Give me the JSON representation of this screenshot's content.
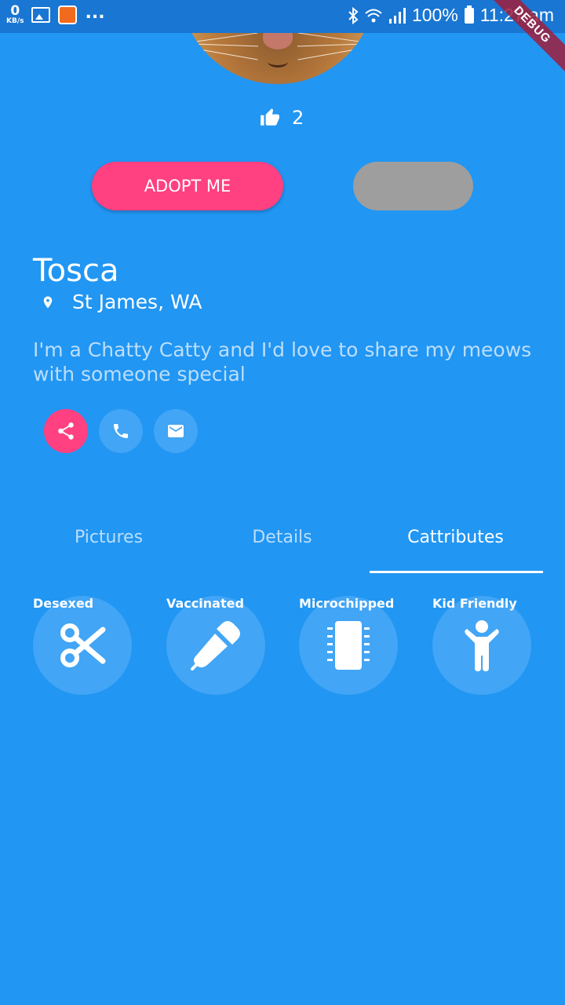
{
  "status_bar": {
    "speed_value": "0",
    "speed_unit": "KB/s",
    "more": "...",
    "battery": "100%",
    "time": "11:27 am"
  },
  "debug_banner": "DEBUG",
  "likes": {
    "count": "2"
  },
  "buttons": {
    "adopt_label": "ADOPT ME"
  },
  "pet": {
    "name": "Tosca",
    "location": "St James, WA",
    "bio": "I'm a Chatty Catty and I'd love to share my meows with someone special"
  },
  "tabs": [
    {
      "label": "Pictures"
    },
    {
      "label": "Details"
    },
    {
      "label": "Cattributes"
    }
  ],
  "active_tab": "Cattributes",
  "cattributes": [
    {
      "label": "Desexed",
      "icon": "scissors-icon"
    },
    {
      "label": "Vaccinated",
      "icon": "dropper-icon"
    },
    {
      "label": "Microchipped",
      "icon": "microchip-icon"
    },
    {
      "label": "Kid Friendly",
      "icon": "child-icon"
    }
  ],
  "colors": {
    "background": "#2196F3",
    "accent": "#FF4081",
    "circle": "#42A5F5",
    "disabled_button": "#9E9E9E"
  }
}
